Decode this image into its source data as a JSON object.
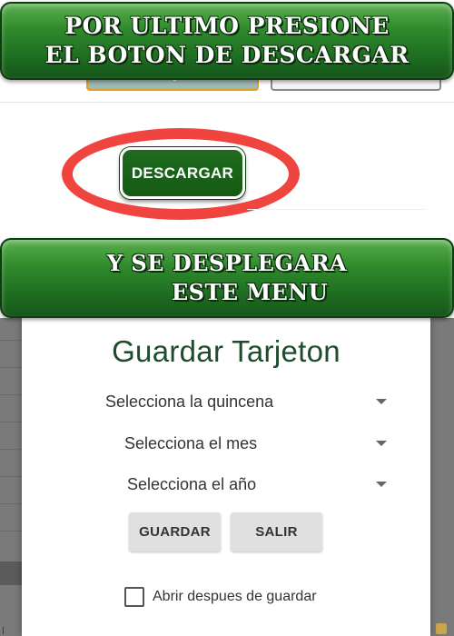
{
  "instructions": {
    "top_banner": {
      "line1": "POR ULTIMO PRESIONE",
      "line2": "EL BOTON DE DESCARGAR"
    },
    "middle_banner": {
      "line1": "Y SE DESPLEGARA",
      "line2": "ESTE MENU"
    }
  },
  "app": {
    "download_button_label": "DESCARGAR",
    "highlight_color": "#f0453f",
    "button_color": "#1a631a"
  },
  "dialog": {
    "title": "Guardar Tarjeton",
    "selects": [
      {
        "label": "Selecciona la quincena"
      },
      {
        "label": "Selecciona el mes"
      },
      {
        "label": "Selecciona el año"
      }
    ],
    "buttons": {
      "save": "GUARDAR",
      "exit": "SALIR"
    },
    "checkbox": {
      "label": "Abrir despues de guardar",
      "checked": false
    }
  }
}
